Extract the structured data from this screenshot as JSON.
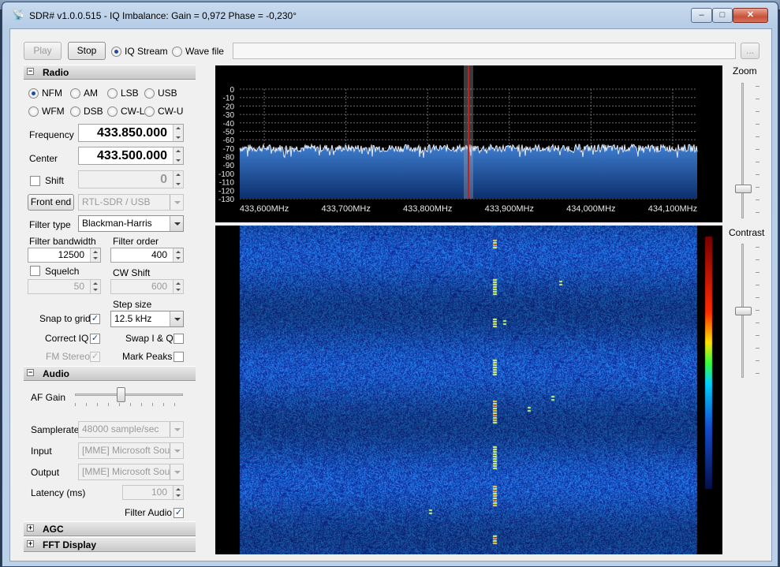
{
  "window": {
    "title": "SDR# v1.0.0.515 - IQ Imbalance: Gain = 0,972 Phase = -0,230°",
    "minimize": "–",
    "maximize": "□",
    "close": "✕"
  },
  "toolbar": {
    "play_label": "Play",
    "stop_label": "Stop",
    "iq_stream_label": "IQ Stream",
    "wave_file_label": "Wave file",
    "source_selected": "iq_stream",
    "file_path": "",
    "browse_label": "..."
  },
  "radio": {
    "header": "Radio",
    "modes": [
      {
        "label": "NFM",
        "selected": true
      },
      {
        "label": "AM",
        "selected": false
      },
      {
        "label": "LSB",
        "selected": false
      },
      {
        "label": "USB",
        "selected": false
      },
      {
        "label": "WFM",
        "selected": false
      },
      {
        "label": "DSB",
        "selected": false
      },
      {
        "label": "CW-L",
        "selected": false
      },
      {
        "label": "CW-U",
        "selected": false
      }
    ],
    "frequency_label": "Frequency",
    "frequency_value": "433.850.000",
    "center_label": "Center",
    "center_value": "433.500.000",
    "shift_label": "Shift",
    "shift_value": "0",
    "shift_checked": false,
    "front_end_label": "Front end",
    "front_end_device": "RTL-SDR / USB",
    "filter_type_label": "Filter type",
    "filter_type_value": "Blackman-Harris",
    "filter_bandwidth_label": "Filter bandwidth",
    "filter_bandwidth_value": "12500",
    "filter_order_label": "Filter order",
    "filter_order_value": "400",
    "squelch_label": "Squelch",
    "squelch_checked": false,
    "squelch_value": "50",
    "cw_shift_label": "CW Shift",
    "cw_shift_value": "600",
    "step_size_label": "Step size",
    "step_size_value": "12.5 kHz",
    "snap_to_grid_label": "Snap to grid",
    "snap_to_grid_checked": true,
    "correct_iq_label": "Correct IQ",
    "correct_iq_checked": true,
    "swap_iq_label": "Swap I & Q",
    "swap_iq_checked": false,
    "fm_stereo_label": "FM Stereo",
    "fm_stereo_checked": true,
    "mark_peaks_label": "Mark Peaks",
    "mark_peaks_checked": false
  },
  "audio": {
    "header": "Audio",
    "af_gain_label": "AF Gain",
    "af_gain_level": 0.42,
    "samplerate_label": "Samplerate",
    "samplerate_value": "48000 sample/sec",
    "input_label": "Input",
    "input_value": "[MME] Microsoft Sound",
    "output_label": "Output",
    "output_value": "[MME] Microsoft Sound",
    "latency_label": "Latency (ms)",
    "latency_value": "100",
    "filter_audio_label": "Filter Audio",
    "filter_audio_checked": true
  },
  "collapsed_sections": {
    "agc": "AGC",
    "fft_display": "FFT Display"
  },
  "spectrum": {
    "y_ticks": [
      "0",
      "-10",
      "-20",
      "-30",
      "-40",
      "-50",
      "-60",
      "-70",
      "-80",
      "-90",
      "-100",
      "-110",
      "-120",
      "-130"
    ],
    "x_ticks": [
      "433,600MHz",
      "433,700MHz",
      "433,800MHz",
      "433,900MHz",
      "434,000MHz",
      "434,100MHz"
    ],
    "noise_floor_db": -70,
    "tuned_mhz": 433.85
  },
  "side": {
    "zoom_label": "Zoom",
    "zoom_level": 0.2,
    "contrast_label": "Contrast",
    "contrast_level": 0.5
  },
  "colors": {
    "spectrum_fill": "#1f5da8",
    "waterfall_bg": "#1a2f9c",
    "tuned_marker": "#c02020",
    "grid": "#6b6b6b"
  }
}
